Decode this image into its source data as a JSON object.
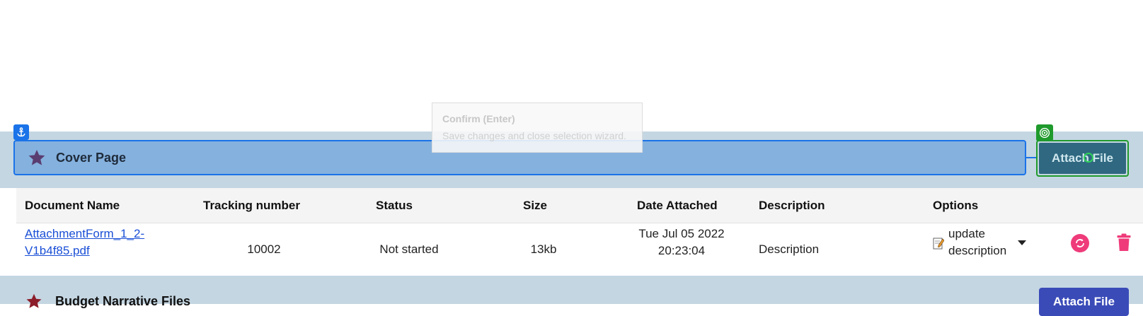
{
  "tooltip": {
    "title": "Confirm (Enter)",
    "text": "Save changes and close selection wizard."
  },
  "sections": [
    {
      "title": "Cover Page",
      "attach_label": "Attach File",
      "star_icon": "star-icon",
      "star_color": "#5a3d70"
    },
    {
      "title": "Budget Narrative Files",
      "attach_label": "Attach File",
      "star_icon": "star-icon",
      "star_color": "#8b1e2a"
    }
  ],
  "table": {
    "headers": {
      "document_name": "Document Name",
      "tracking_number": "Tracking number",
      "status": "Status",
      "size": "Size",
      "date_attached": "Date Attached",
      "description": "Description",
      "options": "Options"
    },
    "rows": [
      {
        "document_name_line1": "AttachmentForm_1_2-",
        "document_name_line2": "V1b4f85.pdf",
        "tracking_number": "10002",
        "status": "Not started",
        "size": "13kb",
        "date_line1": "Tue Jul 05 2022",
        "date_line2": "20:23:04",
        "description": "Description",
        "option_line1": "update",
        "option_line2": "description"
      }
    ]
  },
  "colors": {
    "accent_blue": "#1a73e8",
    "target_green": "#1f9a2c",
    "replace_pink": "#ef3b7a",
    "delete_pink": "#ef3b7a",
    "attach_blue": "#3a4bb8"
  }
}
